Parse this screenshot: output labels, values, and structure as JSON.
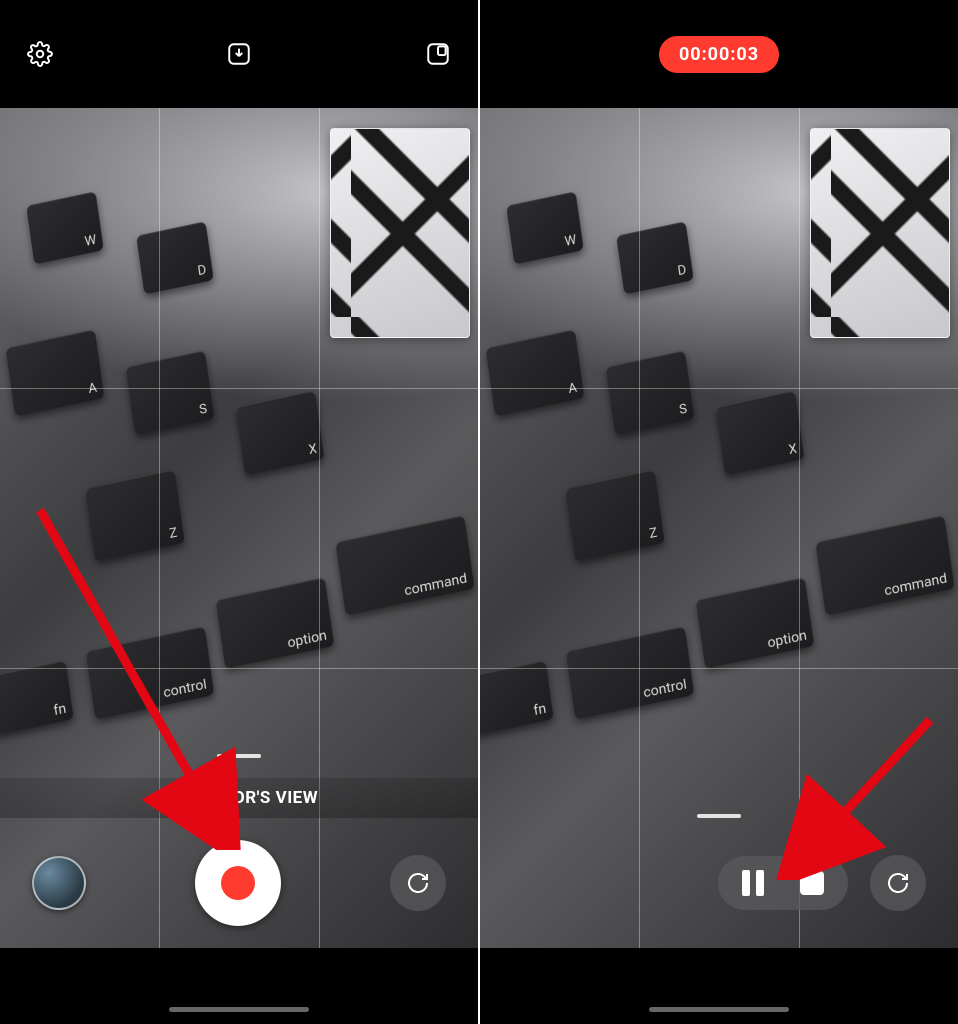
{
  "left": {
    "mode_label": "DIRECTOR'S VIEW",
    "icons": {
      "settings": "settings",
      "save": "save-down",
      "pip_toggle": "pip-layout"
    }
  },
  "right": {
    "timer": "00:00:03"
  },
  "keys": [
    "W",
    "D",
    "A",
    "S",
    "X",
    "Z",
    "fn",
    "control",
    "option",
    "command"
  ],
  "colors": {
    "record_red": "#ff3b30",
    "timer_bg": "#ff3b30"
  }
}
